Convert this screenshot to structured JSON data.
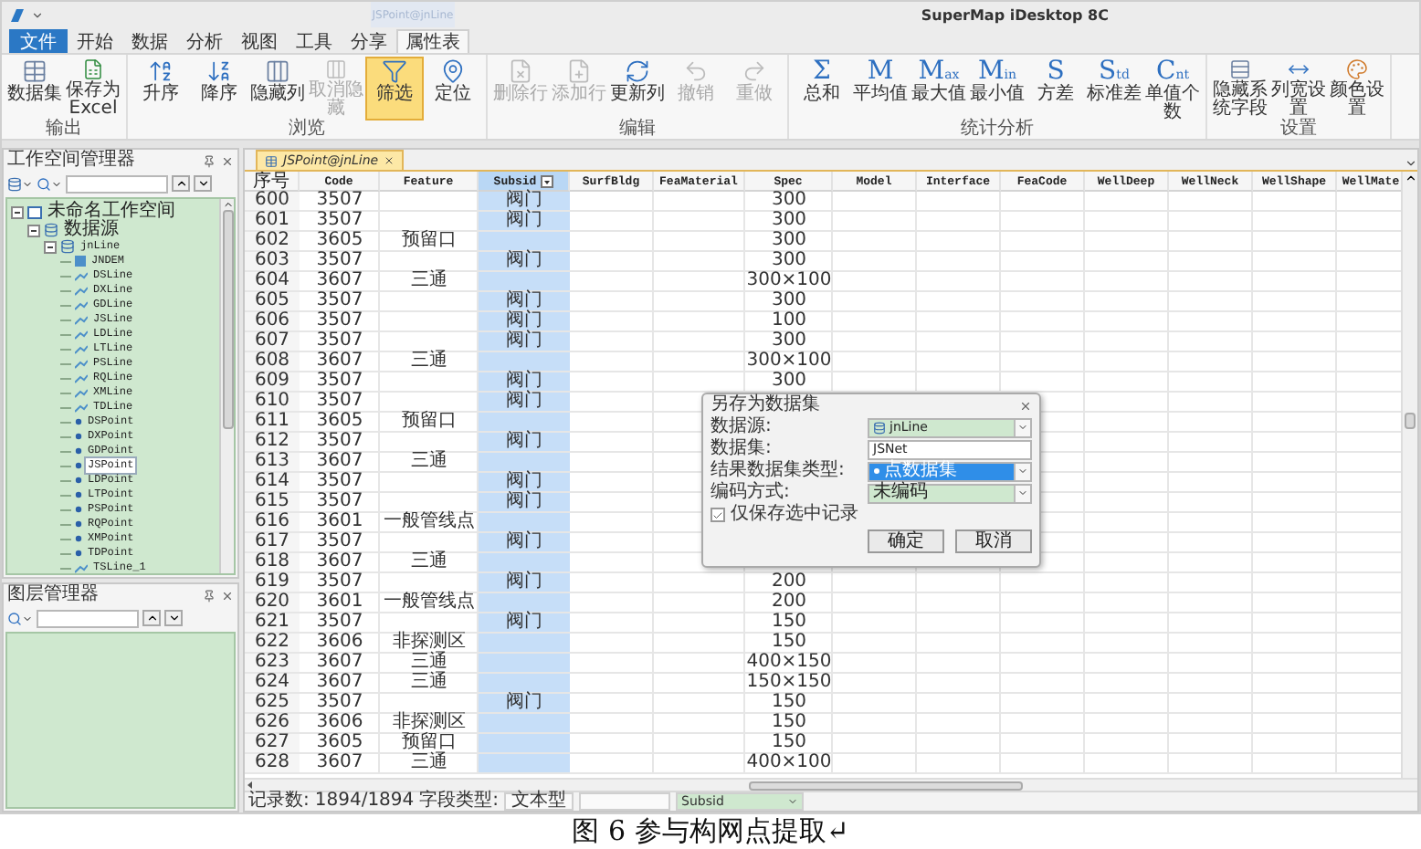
{
  "title_bar": {
    "context_tab": "JSPoint@jnLine",
    "title": "SuperMap iDesktop 8C"
  },
  "ribbon_tabs": [
    {
      "label": "文件",
      "kind": "file",
      "selected": false
    },
    {
      "label": "开始",
      "kind": "tab",
      "selected": false
    },
    {
      "label": "数据",
      "kind": "tab",
      "selected": false
    },
    {
      "label": "分析",
      "kind": "tab",
      "selected": false
    },
    {
      "label": "视图",
      "kind": "tab",
      "selected": false
    },
    {
      "label": "工具",
      "kind": "tab",
      "selected": false
    },
    {
      "label": "分享",
      "kind": "tab",
      "selected": false
    },
    {
      "label": "属性表",
      "kind": "tab",
      "selected": true
    }
  ],
  "ribbon_groups": [
    {
      "label": "输出",
      "buttons": [
        {
          "label": "数据集",
          "disabled": false,
          "selected": false
        },
        {
          "label": "保存为Excel",
          "disabled": false,
          "selected": false
        }
      ]
    },
    {
      "label": "浏览",
      "buttons": [
        {
          "label": "升序",
          "disabled": false,
          "selected": false
        },
        {
          "label": "降序",
          "disabled": false,
          "selected": false
        },
        {
          "label": "隐藏列",
          "disabled": false,
          "selected": false
        },
        {
          "label": "取消隐藏",
          "disabled": true,
          "selected": false
        },
        {
          "label": "筛选",
          "disabled": false,
          "selected": true
        },
        {
          "label": "定位",
          "disabled": false,
          "selected": false
        }
      ]
    },
    {
      "label": "编辑",
      "buttons": [
        {
          "label": "删除行",
          "disabled": true,
          "selected": false
        },
        {
          "label": "添加行",
          "disabled": true,
          "selected": false
        },
        {
          "label": "更新列",
          "disabled": false,
          "selected": false
        },
        {
          "label": "撤销",
          "disabled": true,
          "selected": false
        },
        {
          "label": "重做",
          "disabled": true,
          "selected": false
        }
      ]
    },
    {
      "label": "统计分析",
      "buttons": [
        {
          "label": "总和",
          "glyph": "Σ",
          "disabled": false,
          "selected": false
        },
        {
          "label": "平均值",
          "glyph": "M",
          "disabled": false,
          "selected": false
        },
        {
          "label": "最大值",
          "glyph": "M",
          "sub": "ax",
          "disabled": false,
          "selected": false
        },
        {
          "label": "最小值",
          "glyph": "M",
          "sub": "in",
          "disabled": false,
          "selected": false
        },
        {
          "label": "方差",
          "glyph": "S",
          "disabled": false,
          "selected": false
        },
        {
          "label": "标准差",
          "glyph": "S",
          "sub": "td",
          "disabled": false,
          "selected": false
        },
        {
          "label": "单值个数",
          "glyph": "C",
          "sub": "nt",
          "disabled": false,
          "selected": false
        }
      ]
    },
    {
      "label": "设置",
      "buttons": [
        {
          "label": "隐藏系统字段",
          "disabled": false,
          "selected": false
        },
        {
          "label": "列宽设置",
          "disabled": false,
          "selected": false
        },
        {
          "label": "颜色设置",
          "disabled": false,
          "selected": false
        }
      ]
    }
  ],
  "workspace_panel": {
    "title": "工作空间管理器",
    "tree": [
      {
        "label": "未命名工作空间",
        "kind": "workspace",
        "expanded": true,
        "selected": false,
        "children": [
          {
            "label": "数据源",
            "kind": "folder",
            "expanded": true,
            "selected": false,
            "children": [
              {
                "label": "jnLine",
                "kind": "datasource",
                "expanded": true,
                "selected": false,
                "children": [
                  {
                    "label": "JNDEM",
                    "kind": "grid",
                    "selected": false
                  },
                  {
                    "label": "DSLine",
                    "kind": "line",
                    "selected": false
                  },
                  {
                    "label": "DXLine",
                    "kind": "line",
                    "selected": false
                  },
                  {
                    "label": "GDLine",
                    "kind": "line",
                    "selected": false
                  },
                  {
                    "label": "JSLine",
                    "kind": "line",
                    "selected": false
                  },
                  {
                    "label": "LDLine",
                    "kind": "line",
                    "selected": false
                  },
                  {
                    "label": "LTLine",
                    "kind": "line",
                    "selected": false
                  },
                  {
                    "label": "PSLine",
                    "kind": "line",
                    "selected": false
                  },
                  {
                    "label": "RQLine",
                    "kind": "line",
                    "selected": false
                  },
                  {
                    "label": "XMLine",
                    "kind": "line",
                    "selected": false
                  },
                  {
                    "label": "TDLine",
                    "kind": "line",
                    "selected": false
                  },
                  {
                    "label": "DSPoint",
                    "kind": "point",
                    "selected": false
                  },
                  {
                    "label": "DXPoint",
                    "kind": "point",
                    "selected": false
                  },
                  {
                    "label": "GDPoint",
                    "kind": "point",
                    "selected": false
                  },
                  {
                    "label": "JSPoint",
                    "kind": "point",
                    "selected": true
                  },
                  {
                    "label": "LDPoint",
                    "kind": "point",
                    "selected": false
                  },
                  {
                    "label": "LTPoint",
                    "kind": "point",
                    "selected": false
                  },
                  {
                    "label": "PSPoint",
                    "kind": "point",
                    "selected": false
                  },
                  {
                    "label": "RQPoint",
                    "kind": "point",
                    "selected": false
                  },
                  {
                    "label": "XMPoint",
                    "kind": "point",
                    "selected": false
                  },
                  {
                    "label": "TDPoint",
                    "kind": "point",
                    "selected": false
                  },
                  {
                    "label": "TSLine_1",
                    "kind": "line",
                    "selected": false
                  }
                ]
              }
            ]
          }
        ]
      }
    ]
  },
  "layer_panel": {
    "title": "图层管理器"
  },
  "document_tab": {
    "label": "JSPoint@jnLine"
  },
  "table": {
    "columns": [
      {
        "label": "序号",
        "selected": false
      },
      {
        "label": "Code",
        "selected": false
      },
      {
        "label": "Feature",
        "selected": false
      },
      {
        "label": "Subsid",
        "selected": true
      },
      {
        "label": "SurfBldg",
        "selected": false
      },
      {
        "label": "FeaMaterial",
        "selected": false
      },
      {
        "label": "Spec",
        "selected": false
      },
      {
        "label": "Model",
        "selected": false
      },
      {
        "label": "Interface",
        "selected": false
      },
      {
        "label": "FeaCode",
        "selected": false
      },
      {
        "label": "WellDeep",
        "selected": false
      },
      {
        "label": "WellNeck",
        "selected": false
      },
      {
        "label": "WellShape",
        "selected": false
      },
      {
        "label": "WellMate",
        "selected": false
      }
    ],
    "rows": [
      {
        "cells": [
          "600",
          "3507",
          null,
          "阀门",
          null,
          null,
          "300"
        ]
      },
      {
        "cells": [
          "601",
          "3507",
          null,
          "阀门",
          null,
          null,
          "300"
        ]
      },
      {
        "cells": [
          "602",
          "3605",
          "预留口",
          null,
          null,
          null,
          "300"
        ]
      },
      {
        "cells": [
          "603",
          "3507",
          null,
          "阀门",
          null,
          null,
          "300"
        ]
      },
      {
        "cells": [
          "604",
          "3607",
          "三通",
          null,
          null,
          null,
          "300×100"
        ]
      },
      {
        "cells": [
          "605",
          "3507",
          null,
          "阀门",
          null,
          null,
          "300"
        ]
      },
      {
        "cells": [
          "606",
          "3507",
          null,
          "阀门",
          null,
          null,
          "100"
        ]
      },
      {
        "cells": [
          "607",
          "3507",
          null,
          "阀门",
          null,
          null,
          "300"
        ]
      },
      {
        "cells": [
          "608",
          "3607",
          "三通",
          null,
          null,
          null,
          "300×100"
        ]
      },
      {
        "cells": [
          "609",
          "3507",
          null,
          "阀门",
          null,
          null,
          "300"
        ]
      },
      {
        "cells": [
          "610",
          "3507",
          null,
          "阀门"
        ]
      },
      {
        "cells": [
          "611",
          "3605",
          "预留口",
          null
        ]
      },
      {
        "cells": [
          "612",
          "3507",
          null,
          "阀门"
        ]
      },
      {
        "cells": [
          "613",
          "3607",
          "三通",
          null
        ]
      },
      {
        "cells": [
          "614",
          "3507",
          null,
          "阀门"
        ]
      },
      {
        "cells": [
          "615",
          "3507",
          null,
          "阀门"
        ]
      },
      {
        "cells": [
          "616",
          "3601",
          "一般管线点",
          null
        ]
      },
      {
        "cells": [
          "617",
          "3507",
          null,
          "阀门"
        ]
      },
      {
        "cells": [
          "618",
          "3607",
          "三通",
          null
        ]
      },
      {
        "cells": [
          "619",
          "3507",
          null,
          "阀门",
          null,
          null,
          "200"
        ]
      },
      {
        "cells": [
          "620",
          "3601",
          "一般管线点",
          null,
          null,
          null,
          "200"
        ]
      },
      {
        "cells": [
          "621",
          "3507",
          null,
          "阀门",
          null,
          null,
          "150"
        ]
      },
      {
        "cells": [
          "622",
          "3606",
          "非探测区",
          null,
          null,
          null,
          "150"
        ]
      },
      {
        "cells": [
          "623",
          "3607",
          "三通",
          null,
          null,
          null,
          "400×150"
        ]
      },
      {
        "cells": [
          "624",
          "3607",
          "三通",
          null,
          null,
          null,
          "150×150"
        ]
      },
      {
        "cells": [
          "625",
          "3507",
          null,
          "阀门",
          null,
          null,
          "150"
        ]
      },
      {
        "cells": [
          "626",
          "3606",
          "非探测区",
          null,
          null,
          null,
          "150"
        ]
      },
      {
        "cells": [
          "627",
          "3605",
          "预留口",
          null,
          null,
          null,
          "150"
        ]
      },
      {
        "cells": [
          "628",
          "3607",
          "三通",
          null,
          null,
          null,
          "400×100"
        ]
      }
    ]
  },
  "status_bar": {
    "record_label": "记录数:",
    "record_count": "1894/1894",
    "field_type_label": "字段类型:",
    "field_type": "文本型",
    "field": "Subsid"
  },
  "dialog": {
    "title": "另存为数据集",
    "fields": [
      {
        "label": "数据源:",
        "value": "jnLine",
        "kind": "datasource"
      },
      {
        "label": "数据集:",
        "value": "JSNet",
        "kind": "input"
      },
      {
        "label": "结果数据集类型:",
        "value": "点数据集",
        "kind": "type"
      },
      {
        "label": "编码方式:",
        "value": "未编码",
        "kind": "select"
      }
    ],
    "checkbox": {
      "label": "仅保存选中记录",
      "checked": true
    },
    "buttons": [
      "确定",
      "取消"
    ]
  },
  "caption": "图 6 参与构网点提取↵"
}
